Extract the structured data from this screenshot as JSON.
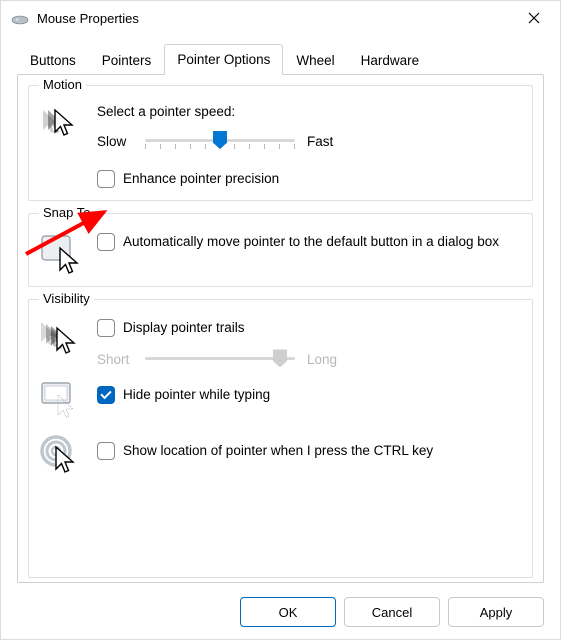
{
  "window": {
    "title": "Mouse Properties"
  },
  "tabs": {
    "items": [
      "Buttons",
      "Pointers",
      "Pointer Options",
      "Wheel",
      "Hardware"
    ],
    "active_index": 2
  },
  "motion": {
    "legend": "Motion",
    "speed_label": "Select a pointer speed:",
    "slow": "Slow",
    "fast": "Fast",
    "speed_value": 6,
    "speed_max": 11,
    "enhance_label": "Enhance pointer precision",
    "enhance_checked": false
  },
  "snap_to": {
    "legend": "Snap To",
    "auto_label": "Automatically move pointer to the default button in a dialog box",
    "auto_checked": false
  },
  "visibility": {
    "legend": "Visibility",
    "trails_label": "Display pointer trails",
    "trails_checked": false,
    "short": "Short",
    "long": "Long",
    "trails_value": 10,
    "trails_max": 11,
    "hide_label": "Hide pointer while typing",
    "hide_checked": true,
    "ctrl_label": "Show location of pointer when I press the CTRL key",
    "ctrl_checked": false
  },
  "buttons": {
    "ok": "OK",
    "cancel": "Cancel",
    "apply": "Apply"
  }
}
